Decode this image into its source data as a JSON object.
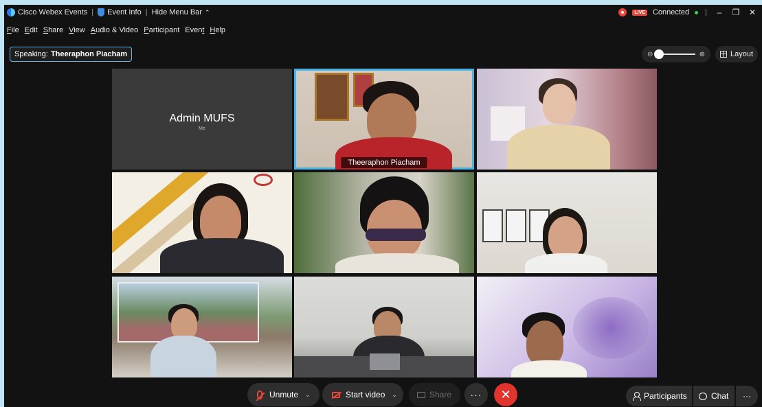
{
  "titlebar": {
    "app_name": "Cisco Webex Events",
    "event_info": "Event Info",
    "hide_menu": "Hide Menu Bar",
    "live_badge": "LIVE",
    "status": "Connected"
  },
  "menu": [
    {
      "key": "F",
      "rest": "ile"
    },
    {
      "key": "E",
      "rest": "dit"
    },
    {
      "key": "S",
      "rest": "hare"
    },
    {
      "key": "V",
      "rest": "iew"
    },
    {
      "key": "A",
      "rest": "udio & Video"
    },
    {
      "key": "P",
      "rest": "articipant"
    },
    {
      "key": "t",
      "pre": "Even",
      "rest": ""
    },
    {
      "key": "H",
      "rest": "elp"
    }
  ],
  "speaking": {
    "label": "Speaking:",
    "name": "Theeraphon Piacham"
  },
  "zoom": {
    "level": 0.0
  },
  "layout_label": "Layout",
  "tiles": {
    "admin": {
      "name": "Admin MUFS",
      "sub": "Me"
    },
    "active": {
      "name": "Theeraphon Piacham"
    }
  },
  "controls": {
    "unmute": "Unmute",
    "start_video": "Start video",
    "share": "Share",
    "participants": "Participants",
    "chat": "Chat"
  },
  "colors": {
    "accent": "#45b4e6",
    "end_call": "#e1342c",
    "muted": "#e8463a",
    "frame": "#bfe6f2"
  }
}
